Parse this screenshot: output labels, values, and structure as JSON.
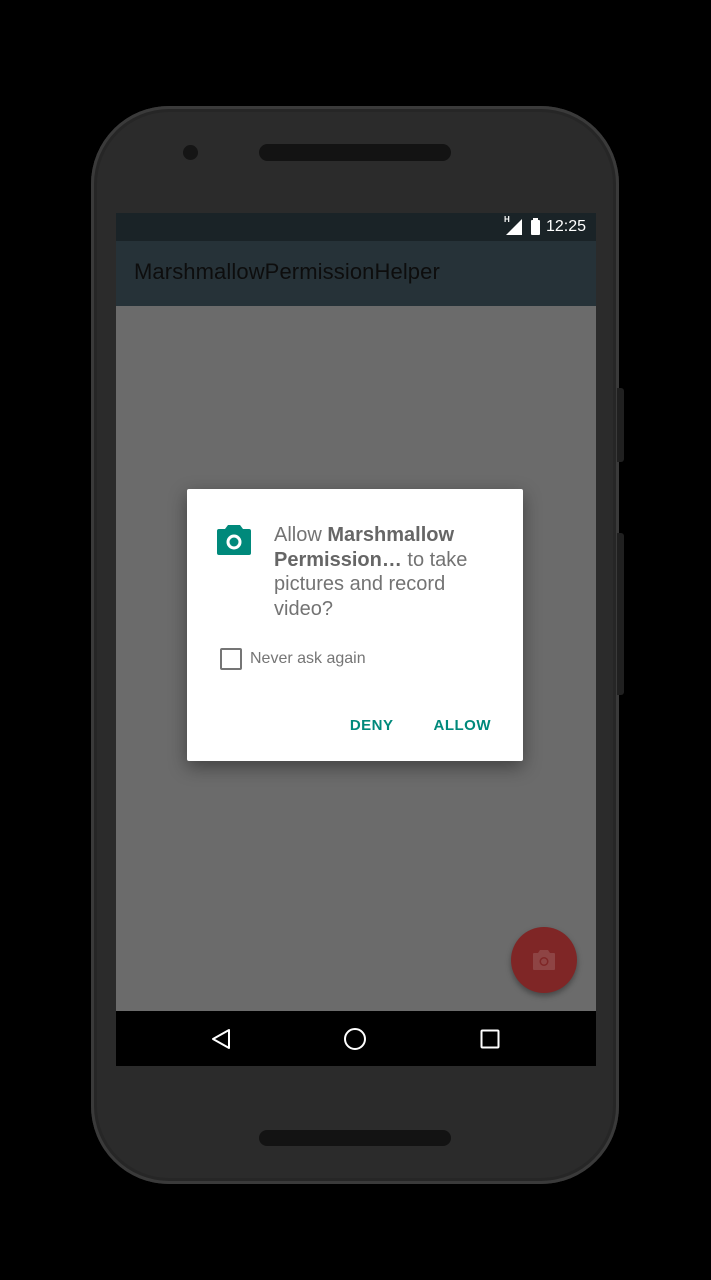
{
  "status_bar": {
    "time": "12:25",
    "network_label": "H"
  },
  "app_bar": {
    "title": "MarshmallowPermissionHelper"
  },
  "dialog": {
    "message_prefix": "Allow ",
    "app_name": "Marshmallow Permission…",
    "message_suffix": " to take pictures and record video?",
    "checkbox_label": "Never ask again",
    "checkbox_checked": false,
    "deny_label": "DENY",
    "allow_label": "ALLOW",
    "icon": "camera-icon"
  },
  "fab": {
    "icon": "camera-icon"
  },
  "nav_bar": {
    "back_icon": "back-triangle-icon",
    "home_icon": "home-circle-icon",
    "recents_icon": "recents-square-icon"
  },
  "colors": {
    "accent": "#00897b",
    "app_bar": "#263238",
    "status_bar": "#1a2327",
    "fab": "#7f2626",
    "scrim": "#6b6b6b"
  }
}
